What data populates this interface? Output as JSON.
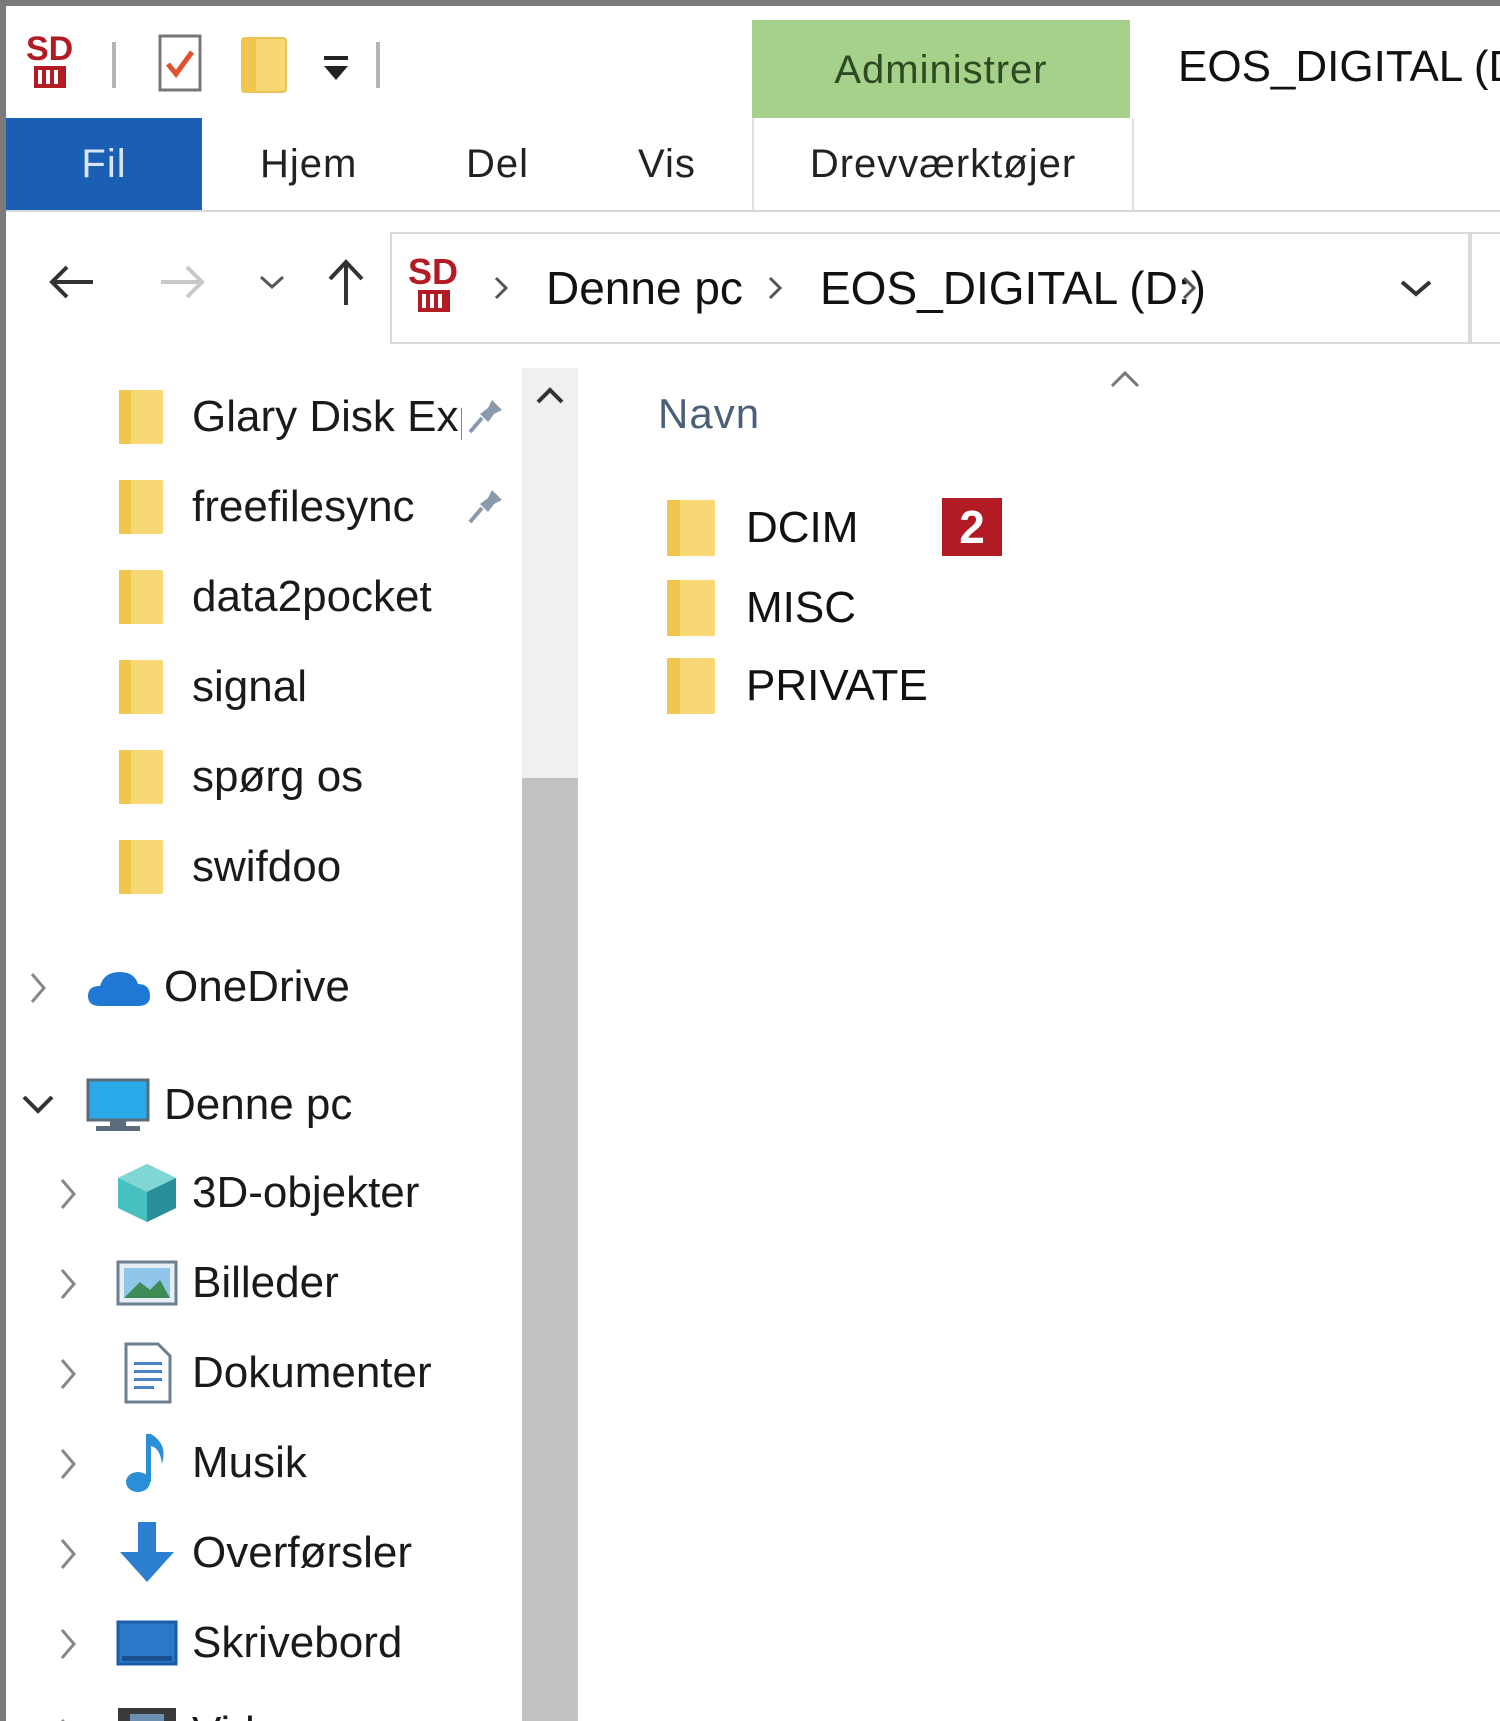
{
  "quick_access_toolbar": {
    "app_icon": "sd-card-icon",
    "items": [
      "properties-icon",
      "new-folder-icon",
      "customize-dropdown-icon"
    ]
  },
  "ribbon": {
    "contextual_group_label": "Administrer",
    "window_title": "EOS_DIGITAL (D:)",
    "tabs": {
      "file": "Fil",
      "home": "Hjem",
      "share": "Del",
      "view": "Vis",
      "drive_tools": "Drevværktøjer"
    }
  },
  "address_bar": {
    "crumbs": [
      "Denne pc",
      "EOS_DIGITAL (D:)"
    ]
  },
  "sidebar": {
    "pinned": [
      {
        "label": "Glary Disk Exp",
        "pinned": true
      },
      {
        "label": "freefilesync",
        "pinned": true
      },
      {
        "label": "data2pocket",
        "pinned": false
      },
      {
        "label": "signal",
        "pinned": false
      },
      {
        "label": "spørg os",
        "pinned": false
      },
      {
        "label": "swifdoo",
        "pinned": false
      }
    ],
    "onedrive": "OneDrive",
    "this_pc": "Denne pc",
    "this_pc_children": [
      {
        "label": "3D-objekter",
        "icon": "3d-objects-icon"
      },
      {
        "label": "Billeder",
        "icon": "pictures-icon"
      },
      {
        "label": "Dokumenter",
        "icon": "documents-icon"
      },
      {
        "label": "Musik",
        "icon": "music-icon"
      },
      {
        "label": "Overførsler",
        "icon": "downloads-icon"
      },
      {
        "label": "Skrivebord",
        "icon": "desktop-icon"
      },
      {
        "label": "Videoer",
        "icon": "videos-icon"
      }
    ]
  },
  "content": {
    "column_header": "Navn",
    "files": [
      {
        "name": "DCIM",
        "badge": "2"
      },
      {
        "name": "MISC"
      },
      {
        "name": "PRIVATE"
      }
    ]
  },
  "colors": {
    "file_tab": "#1a5fb4",
    "manage_tab": "#a5d18b",
    "badge": "#b31b24",
    "folder": "#f8d775"
  }
}
